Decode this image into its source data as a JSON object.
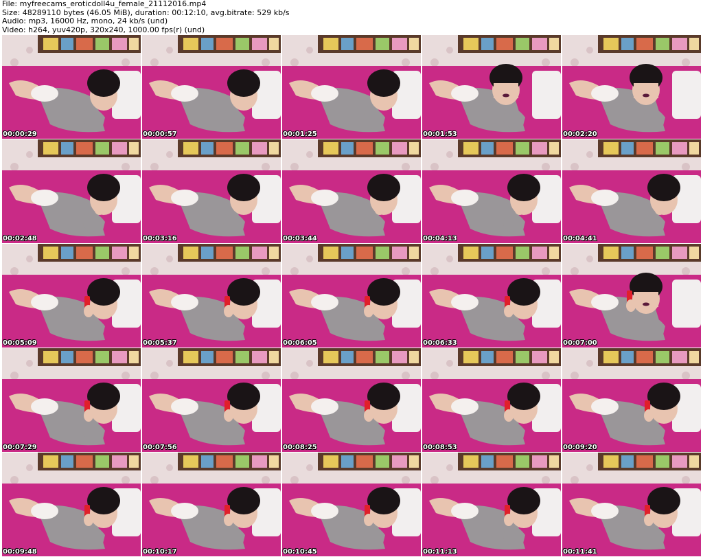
{
  "header": {
    "file": "File: myfreecams_eroticdoll4u_female_21112016.mp4",
    "size": "Size: 48289110 bytes (46.05 MiB), duration: 00:12:10, avg.bitrate: 529 kb/s",
    "audio": "Audio: mp3, 16000 Hz, mono, 24 kb/s (und)",
    "video": "Video: h264, yuv420p, 320x240, 1000.00 fps(r) (und)"
  },
  "thumbnails": [
    {
      "timestamp": "00:00:29",
      "pose": "lying-look-down"
    },
    {
      "timestamp": "00:00:57",
      "pose": "lying-look-down"
    },
    {
      "timestamp": "00:01:25",
      "pose": "lying-look-down"
    },
    {
      "timestamp": "00:01:53",
      "pose": "lying-face-camera"
    },
    {
      "timestamp": "00:02:20",
      "pose": "lying-face-camera"
    },
    {
      "timestamp": "00:02:48",
      "pose": "lying-hand-face"
    },
    {
      "timestamp": "00:03:16",
      "pose": "lying-look-down"
    },
    {
      "timestamp": "00:03:44",
      "pose": "lying-hand-face"
    },
    {
      "timestamp": "00:04:13",
      "pose": "lying-hand-face"
    },
    {
      "timestamp": "00:04:41",
      "pose": "lying-hand-face"
    },
    {
      "timestamp": "00:05:09",
      "pose": "lying-phone"
    },
    {
      "timestamp": "00:05:37",
      "pose": "lying-phone"
    },
    {
      "timestamp": "00:06:05",
      "pose": "lying-phone"
    },
    {
      "timestamp": "00:06:33",
      "pose": "lying-phone"
    },
    {
      "timestamp": "00:07:00",
      "pose": "lying-phone-camera"
    },
    {
      "timestamp": "00:07:29",
      "pose": "lying-phone"
    },
    {
      "timestamp": "00:07:56",
      "pose": "lying-phone"
    },
    {
      "timestamp": "00:08:25",
      "pose": "lying-phone"
    },
    {
      "timestamp": "00:08:53",
      "pose": "lying-phone"
    },
    {
      "timestamp": "00:09:20",
      "pose": "lying-phone"
    },
    {
      "timestamp": "00:09:48",
      "pose": "lying-phone"
    },
    {
      "timestamp": "00:10:17",
      "pose": "lying-phone"
    },
    {
      "timestamp": "00:10:45",
      "pose": "lying-phone"
    },
    {
      "timestamp": "00:11:13",
      "pose": "lying-phone"
    },
    {
      "timestamp": "00:11:41",
      "pose": "lying-phone"
    }
  ],
  "colors": {
    "bedsheet": "#c92a86",
    "wall": "#e9dcdc",
    "shelf": "#5a3a2a",
    "sweater": "#9a9699",
    "skin": "#e8c4b0",
    "hair": "#1a1416",
    "pillow": "#f2efef",
    "phone": "#e0202a"
  }
}
